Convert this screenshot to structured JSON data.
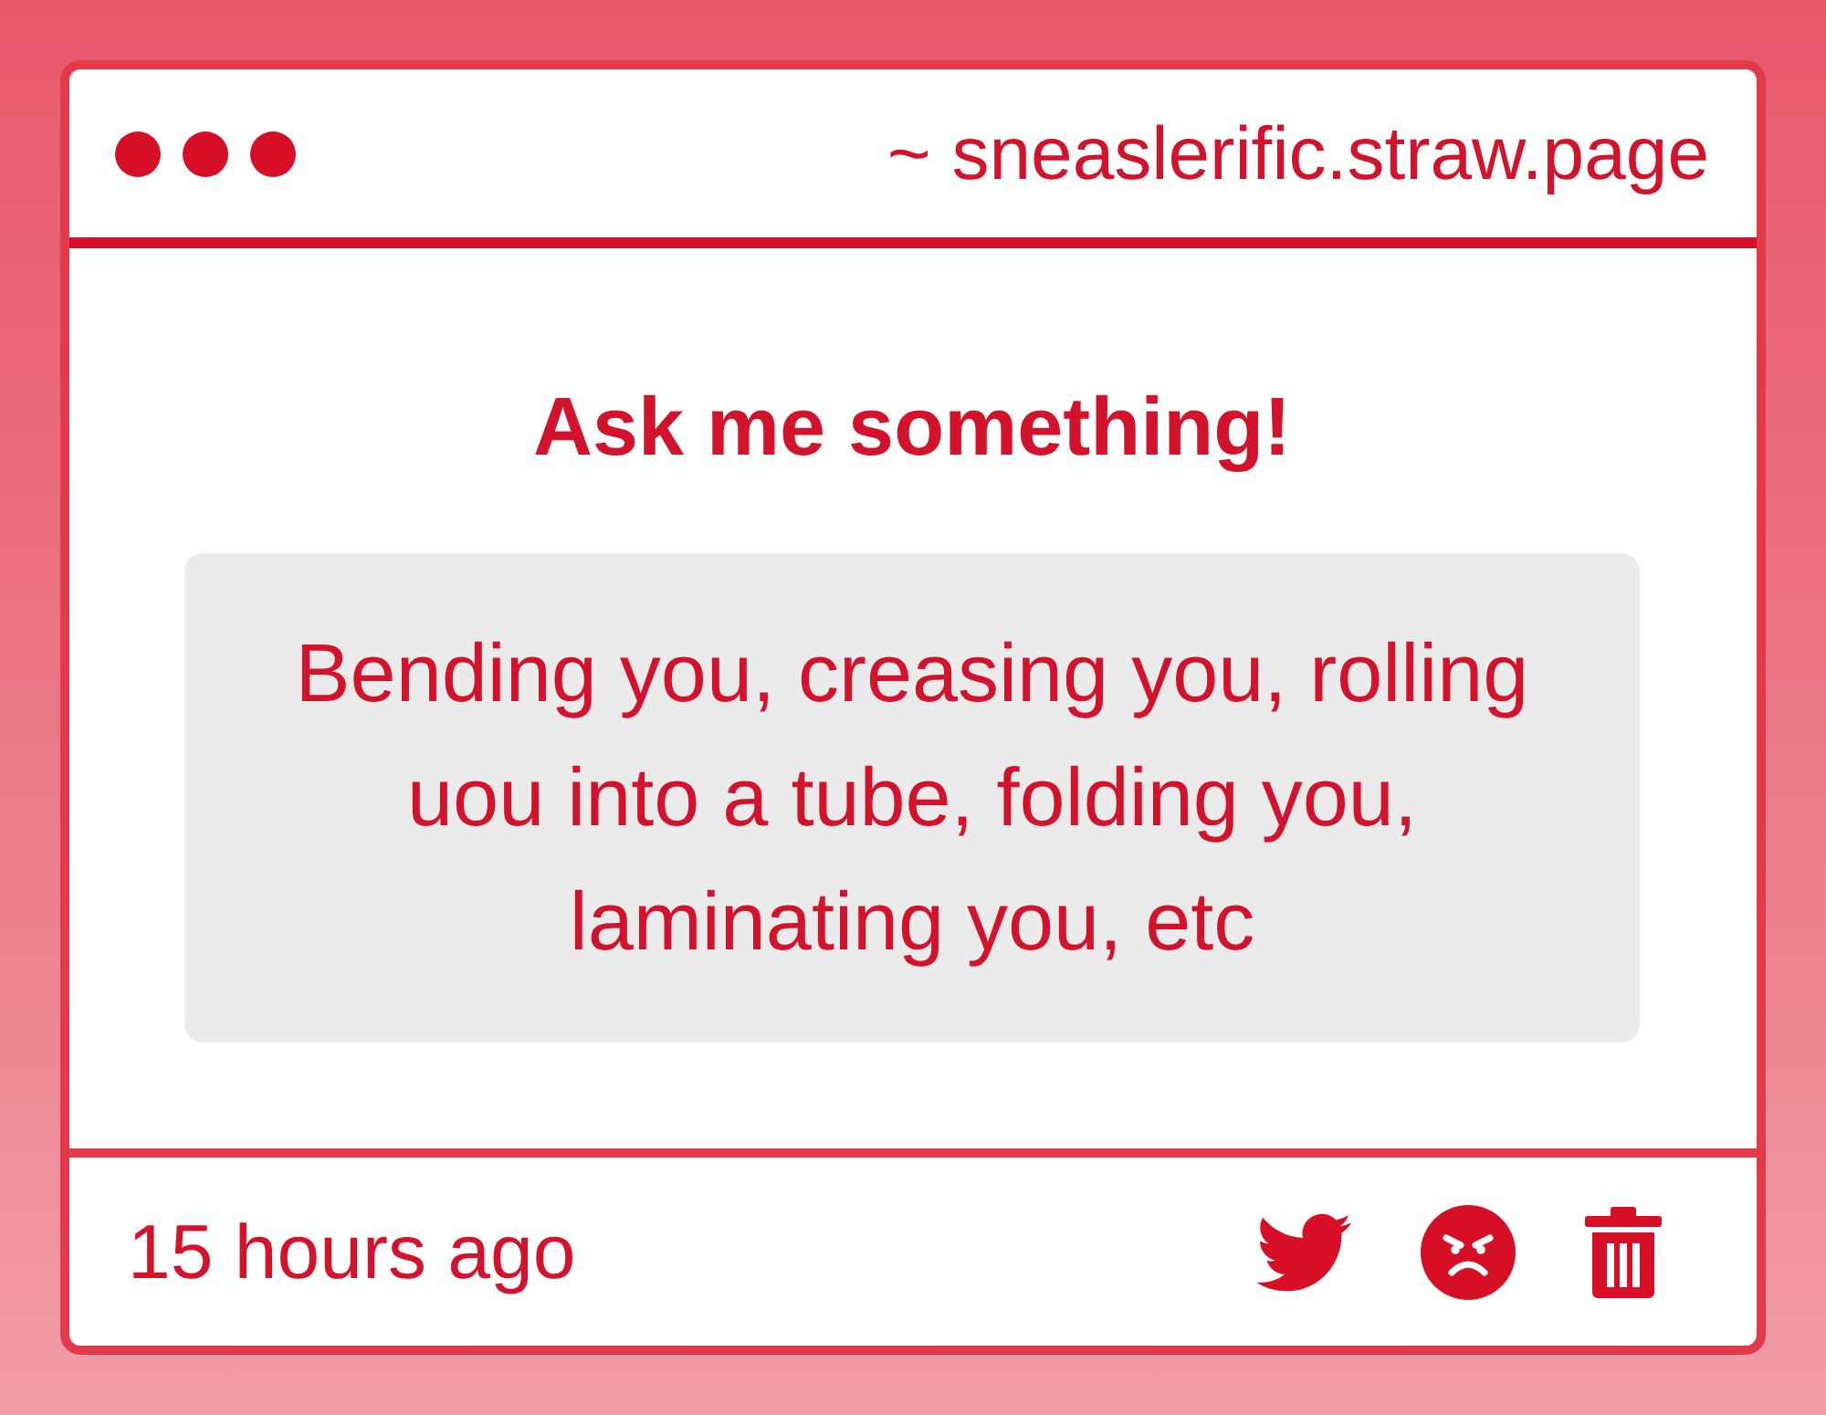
{
  "address_bar": {
    "url": "~ sneaslerific.straw.page"
  },
  "prompt": {
    "title": "Ask me something!"
  },
  "question": {
    "text": "Bending you, creasing you, rolling uou into a tube, folding you, laminating you, etc"
  },
  "footer": {
    "time": "15 hours ago"
  }
}
